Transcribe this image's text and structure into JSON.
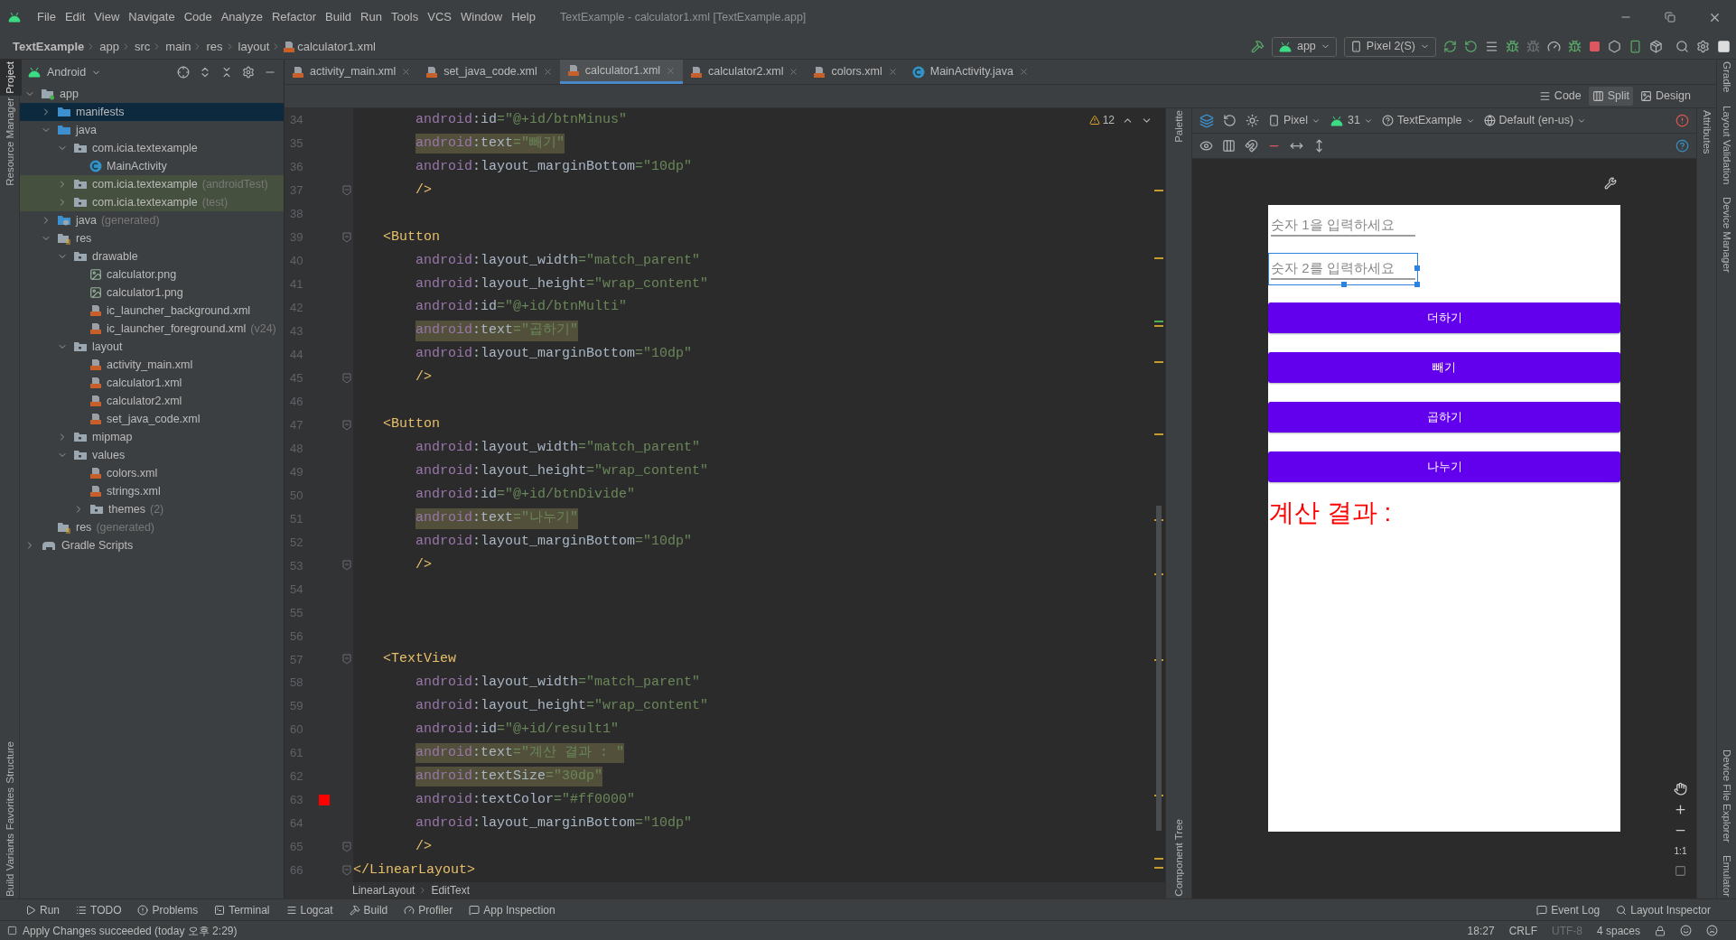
{
  "window": {
    "title": "TextExample - calculator1.xml [TextExample.app]",
    "menu": [
      "File",
      "Edit",
      "View",
      "Navigate",
      "Code",
      "Analyze",
      "Refactor",
      "Build",
      "Run",
      "Tools",
      "VCS",
      "Window",
      "Help"
    ]
  },
  "nav_bar": {
    "breadcrumbs": [
      "TextExample",
      "app",
      "src",
      "main",
      "res",
      "layout",
      "calculator1.xml"
    ],
    "run_config": "app",
    "device": "Pixel 2(S)"
  },
  "left_strip": {
    "top": [
      {
        "label": "Project",
        "selected": true
      },
      {
        "label": "Resource Manager",
        "selected": false
      }
    ],
    "bottom": [
      {
        "label": "Structure",
        "selected": false
      },
      {
        "label": "Favorites",
        "selected": false
      },
      {
        "label": "Build Variants",
        "selected": false
      }
    ]
  },
  "project_panel": {
    "view": "Android",
    "tree": [
      {
        "label": "app",
        "kind": "module",
        "expanded": true,
        "selected": false,
        "highlighted": false,
        "children": [
          {
            "label": "manifests",
            "kind": "source_folder",
            "expanded": false,
            "selected": true,
            "highlighted": false
          },
          {
            "label": "java",
            "kind": "source_folder",
            "expanded": true,
            "selected": false,
            "highlighted": false,
            "children": [
              {
                "label": "com.icia.textexample",
                "kind": "package",
                "expanded": true,
                "selected": false,
                "highlighted": false,
                "children": [
                  {
                    "label": "MainActivity",
                    "kind": "class",
                    "selected": false,
                    "highlighted": false
                  }
                ]
              },
              {
                "label": "com.icia.textexample",
                "note": "(androidTest)",
                "kind": "package",
                "expanded": false,
                "selected": false,
                "highlighted": true
              },
              {
                "label": "com.icia.textexample",
                "note": "(test)",
                "kind": "package",
                "expanded": false,
                "selected": false,
                "highlighted": true
              }
            ]
          },
          {
            "label": "java",
            "note": "(generated)",
            "kind": "generated",
            "expanded": false,
            "selected": false,
            "highlighted": false
          },
          {
            "label": "res",
            "kind": "res",
            "expanded": true,
            "selected": false,
            "highlighted": false,
            "children": [
              {
                "label": "drawable",
                "kind": "package",
                "expanded": true,
                "selected": false,
                "highlighted": false,
                "children": [
                  {
                    "label": "calculator.png",
                    "kind": "image",
                    "selected": false,
                    "highlighted": false
                  },
                  {
                    "label": "calculator1.png",
                    "kind": "image",
                    "selected": false,
                    "highlighted": false
                  },
                  {
                    "label": "ic_launcher_background.xml",
                    "kind": "xml",
                    "selected": false,
                    "highlighted": false
                  },
                  {
                    "label": "ic_launcher_foreground.xml",
                    "note": "(v24)",
                    "kind": "xml",
                    "selected": false,
                    "highlighted": false
                  }
                ]
              },
              {
                "label": "layout",
                "kind": "package",
                "expanded": true,
                "selected": false,
                "highlighted": false,
                "children": [
                  {
                    "label": "activity_main.xml",
                    "kind": "xml",
                    "selected": false,
                    "highlighted": false
                  },
                  {
                    "label": "calculator1.xml",
                    "kind": "xml",
                    "selected": false,
                    "highlighted": false
                  },
                  {
                    "label": "calculator2.xml",
                    "kind": "xml",
                    "selected": false,
                    "highlighted": false
                  },
                  {
                    "label": "set_java_code.xml",
                    "kind": "xml",
                    "selected": false,
                    "highlighted": false
                  }
                ]
              },
              {
                "label": "mipmap",
                "kind": "package",
                "expanded": false,
                "selected": false,
                "highlighted": false
              },
              {
                "label": "values",
                "kind": "package",
                "expanded": true,
                "selected": false,
                "highlighted": false,
                "children": [
                  {
                    "label": "colors.xml",
                    "kind": "xml",
                    "selected": false,
                    "highlighted": false
                  },
                  {
                    "label": "strings.xml",
                    "kind": "xml",
                    "selected": false,
                    "highlighted": false
                  },
                  {
                    "label": "themes",
                    "note": "(2)",
                    "kind": "package",
                    "expanded": false,
                    "selected": false,
                    "highlighted": false
                  }
                ]
              }
            ]
          },
          {
            "label": "res",
            "note": "(generated)",
            "kind": "res",
            "selected": false,
            "highlighted": false
          }
        ]
      },
      {
        "label": "Gradle Scripts",
        "kind": "gradle",
        "expanded": false,
        "selected": false,
        "highlighted": false
      }
    ]
  },
  "editor_tabs": [
    {
      "label": "activity_main.xml",
      "kind": "xml",
      "selected": false
    },
    {
      "label": "set_java_code.xml",
      "kind": "xml",
      "selected": false
    },
    {
      "label": "calculator1.xml",
      "kind": "xml",
      "selected": true
    },
    {
      "label": "calculator2.xml",
      "kind": "xml",
      "selected": false
    },
    {
      "label": "colors.xml",
      "kind": "xml",
      "selected": false
    },
    {
      "label": "MainActivity.java",
      "kind": "java",
      "selected": false
    }
  ],
  "view_modes": [
    {
      "label": "Code",
      "selected": false
    },
    {
      "label": "Split",
      "selected": true
    },
    {
      "label": "Design",
      "selected": false
    }
  ],
  "editor": {
    "warnings": "12",
    "lines": [
      {
        "number": "34",
        "kind": "attr",
        "parts": [
          "android",
          ":id",
          "=\"@+id/btnMinus\""
        ],
        "highlighted": false
      },
      {
        "number": "35",
        "kind": "attr",
        "parts": [
          "android",
          ":text",
          "=\"빼기\""
        ],
        "highlighted": true
      },
      {
        "number": "36",
        "kind": "attr",
        "parts": [
          "android",
          ":layout_marginBottom",
          "=\"10dp\""
        ],
        "highlighted": false
      },
      {
        "number": "37",
        "kind": "tag_end",
        "text": "/>"
      },
      {
        "number": "38",
        "kind": "blank"
      },
      {
        "number": "39",
        "kind": "open_tag",
        "text": "<Button"
      },
      {
        "number": "40",
        "kind": "attr",
        "parts": [
          "android",
          ":layout_width",
          "=\"match_parent\""
        ],
        "highlighted": false
      },
      {
        "number": "41",
        "kind": "attr",
        "parts": [
          "android",
          ":layout_height",
          "=\"wrap_content\""
        ],
        "highlighted": false
      },
      {
        "number": "42",
        "kind": "attr",
        "parts": [
          "android",
          ":id",
          "=\"@+id/btnMulti\""
        ],
        "highlighted": false
      },
      {
        "number": "43",
        "kind": "attr",
        "parts": [
          "android",
          ":text",
          "=\"곱하기\""
        ],
        "highlighted": true
      },
      {
        "number": "44",
        "kind": "attr",
        "parts": [
          "android",
          ":layout_marginBottom",
          "=\"10dp\""
        ],
        "highlighted": false
      },
      {
        "number": "45",
        "kind": "tag_end",
        "text": "/>"
      },
      {
        "number": "46",
        "kind": "blank"
      },
      {
        "number": "47",
        "kind": "open_tag",
        "text": "<Button"
      },
      {
        "number": "48",
        "kind": "attr",
        "parts": [
          "android",
          ":layout_width",
          "=\"match_parent\""
        ],
        "highlighted": false
      },
      {
        "number": "49",
        "kind": "attr",
        "parts": [
          "android",
          ":layout_height",
          "=\"wrap_content\""
        ],
        "highlighted": false
      },
      {
        "number": "50",
        "kind": "attr",
        "parts": [
          "android",
          ":id",
          "=\"@+id/btnDivide\""
        ],
        "highlighted": false
      },
      {
        "number": "51",
        "kind": "attr",
        "parts": [
          "android",
          ":text",
          "=\"나누기\""
        ],
        "highlighted": true
      },
      {
        "number": "52",
        "kind": "attr",
        "parts": [
          "android",
          ":layout_marginBottom",
          "=\"10dp\""
        ],
        "highlighted": false
      },
      {
        "number": "53",
        "kind": "tag_end",
        "text": "/>"
      },
      {
        "number": "54",
        "kind": "blank"
      },
      {
        "number": "55",
        "kind": "blank"
      },
      {
        "number": "56",
        "kind": "blank"
      },
      {
        "number": "57",
        "kind": "open_tag",
        "text": "<TextView"
      },
      {
        "number": "58",
        "kind": "attr",
        "parts": [
          "android",
          ":layout_width",
          "=\"match_parent\""
        ],
        "highlighted": false
      },
      {
        "number": "59",
        "kind": "attr",
        "parts": [
          "android",
          ":layout_height",
          "=\"wrap_content\""
        ],
        "highlighted": false
      },
      {
        "number": "60",
        "kind": "attr",
        "parts": [
          "android",
          ":id",
          "=\"@+id/result1\""
        ],
        "highlighted": false
      },
      {
        "number": "61",
        "kind": "attr",
        "parts": [
          "android",
          ":text",
          "=\"계산 결과 : \""
        ],
        "highlighted": true
      },
      {
        "number": "62",
        "kind": "attr",
        "parts": [
          "android",
          ":textSize",
          "=\"30dp\""
        ],
        "highlighted": true
      },
      {
        "number": "63",
        "kind": "attr",
        "parts": [
          "android",
          ":textColor",
          "=\"#ff0000\""
        ],
        "highlighted": false,
        "gutter_swatch": true
      },
      {
        "number": "64",
        "kind": "attr",
        "parts": [
          "android",
          ":layout_marginBottom",
          "=\"10dp\""
        ],
        "highlighted": false
      },
      {
        "number": "65",
        "kind": "tag_end",
        "text": "/>"
      },
      {
        "number": "66",
        "kind": "root_close",
        "text": "</LinearLayout>"
      }
    ],
    "breadcrumbs": [
      "LinearLayout",
      "EditText"
    ]
  },
  "design_toolbar": {
    "device": "Pixel",
    "api": "31",
    "theme": "TextExample",
    "locale": "Default (en-us)"
  },
  "palette_strip": {
    "top": "Palette",
    "bottom": "Component Tree"
  },
  "attributes_strip": "Attributes",
  "preview": {
    "fields": [
      {
        "placeholder": "숫자 1을 입력하세요",
        "selected": false
      },
      {
        "placeholder": "숫자 2를 입력하세요",
        "selected": true
      }
    ],
    "buttons": [
      "더하기",
      "빼기",
      "곱하기",
      "나누기"
    ],
    "result": "계산 결과 :",
    "zoom_reset": "1:1"
  },
  "right_strip": {
    "top": [
      "Gradle",
      "Layout Validation",
      "Device Manager"
    ],
    "bottom": [
      "Device File Explorer",
      "Emulator"
    ]
  },
  "tool_windows": {
    "left": [
      "Run",
      "TODO",
      "Problems",
      "Terminal",
      "Logcat",
      "Build",
      "Profiler",
      "App Inspection"
    ],
    "right": [
      "Event Log",
      "Layout Inspector"
    ]
  },
  "status_bar": {
    "message": "Apply Changes succeeded (today 오후 2:29)",
    "items": [
      {
        "text": "18:27",
        "disabled": false
      },
      {
        "text": "CRLF",
        "disabled": false
      },
      {
        "text": "UTF-8",
        "disabled": true
      },
      {
        "text": "4 spaces",
        "disabled": false
      }
    ]
  }
}
